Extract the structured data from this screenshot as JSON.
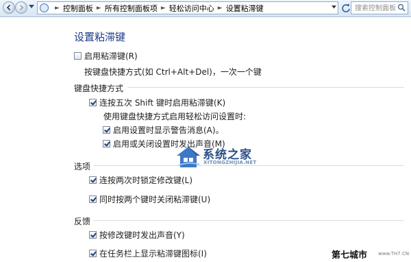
{
  "address_bar": {
    "breadcrumbs": [
      "控制面板",
      "所有控制面板项",
      "轻松访问中心",
      "设置粘滞键"
    ]
  },
  "search": {
    "placeholder": "搜索控制面板"
  },
  "page_title": "设置粘滞键",
  "options": {
    "enable_sticky_keys": {
      "label": "启用粘滞键(R)",
      "checked": false
    },
    "description": "按键盘快捷方式(如 Ctrl+Alt+Del)，一次一个键"
  },
  "keyboard_shortcut": {
    "heading": "键盘快捷方式",
    "shift_five_times": {
      "label": "连按五次 Shift 键时启用粘滞键(K)",
      "checked": true
    },
    "sub_heading": "使用键盘快捷方式启用轻松访问设置时:",
    "show_warning": {
      "label": "启用设置时显示警告消息(A)。",
      "checked": true
    },
    "make_sound": {
      "label": "启用或关闭设置时发出声音(M)",
      "checked": true
    }
  },
  "options_section": {
    "heading": "选项",
    "lock_modifier": {
      "label": "连按两次时锁定修改键(L)",
      "checked": true
    },
    "turn_off_two_keys": {
      "label": "同时按两个键时关闭粘滞键(U)",
      "checked": true
    }
  },
  "feedback": {
    "heading": "反馈",
    "play_sound": {
      "label": "按修改键时发出声音(Y)",
      "checked": true
    },
    "show_icon": {
      "label": "在任务栏上显示粘滞键图标(I)",
      "checked": true
    }
  },
  "watermark": {
    "name": "系统之家",
    "url": "XITONGZHIJIA.NET"
  },
  "corner_watermark": {
    "logo": "第七城市",
    "url": "www.TH7.CN"
  },
  "colors": {
    "title": "#1e3a8a",
    "separator": "#d7dde5",
    "toolbar": "#dbe7f4"
  }
}
